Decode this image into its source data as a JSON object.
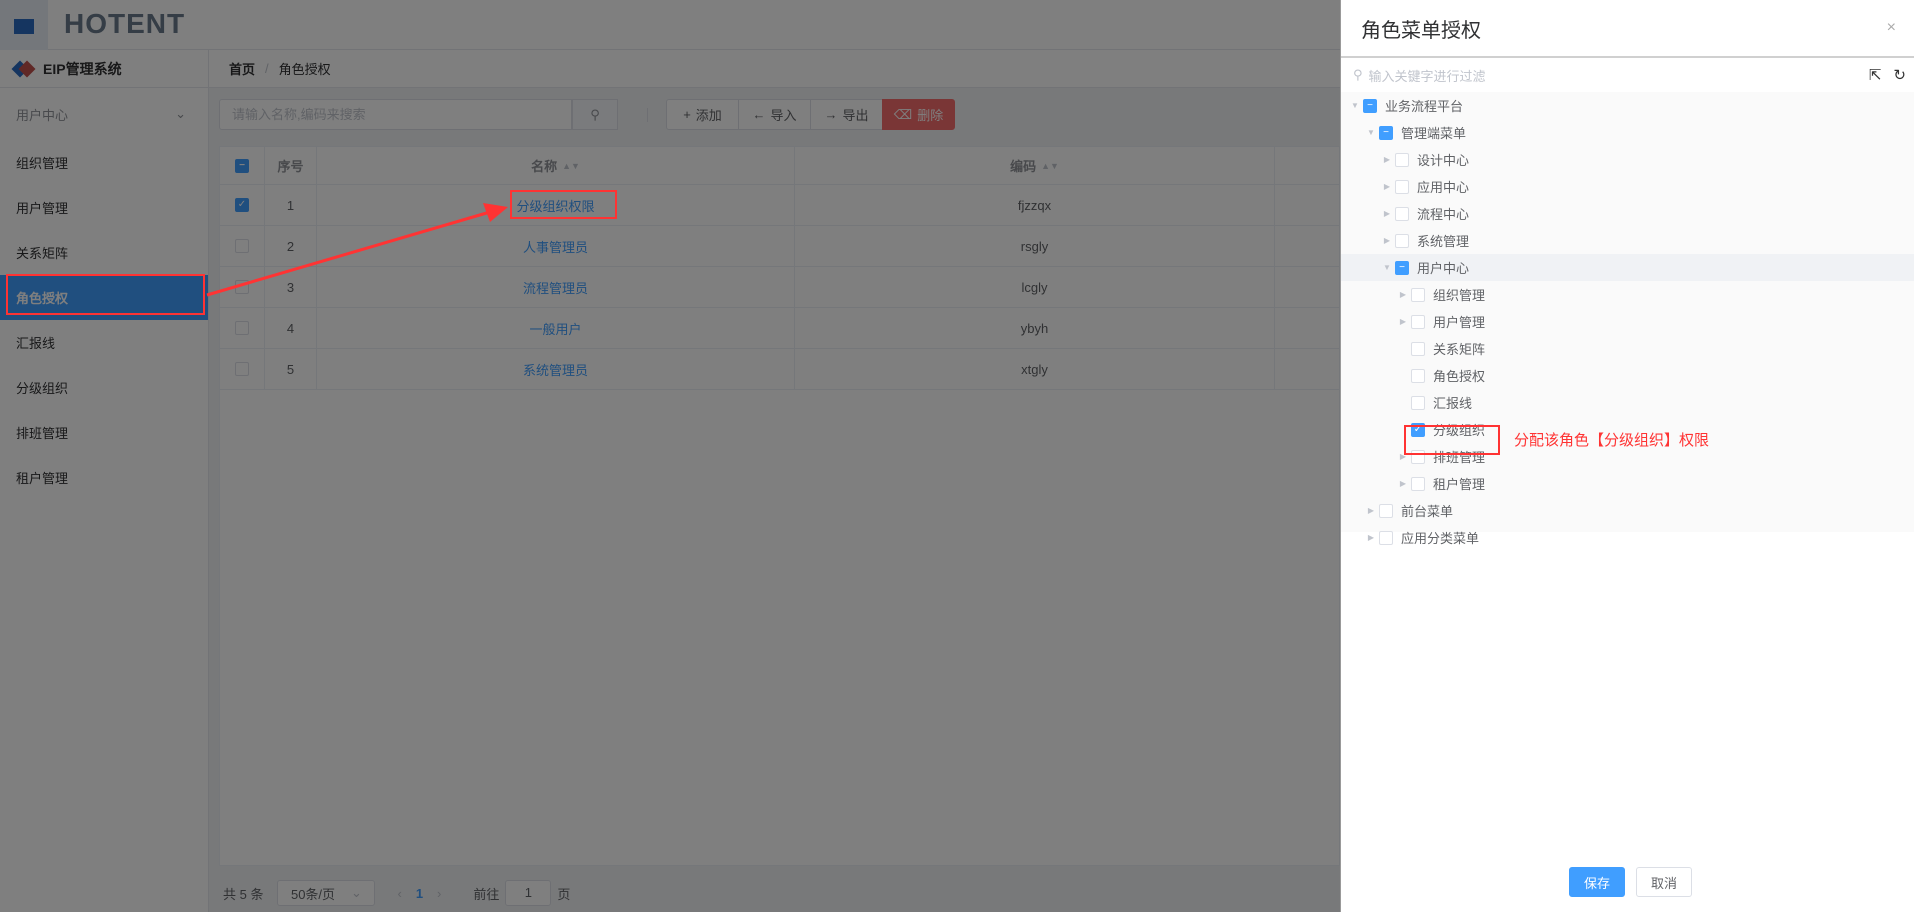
{
  "header": {
    "logo": "HOTENT"
  },
  "sidebar": {
    "system": "EIP管理系统",
    "submenu": "用户中心",
    "items": [
      "组织管理",
      "用户管理",
      "关系矩阵",
      "角色授权",
      "汇报线",
      "分级组织",
      "排班管理",
      "租户管理"
    ],
    "active": "角色授权"
  },
  "breadcrumb": {
    "home": "首页",
    "current": "角色授权"
  },
  "toolbar": {
    "search_placeholder": "请输入名称,编码来搜索",
    "add": "添加",
    "import": "导入",
    "export": "导出",
    "delete": "删除"
  },
  "table": {
    "headers": {
      "index": "序号",
      "name": "名称",
      "code": "编码"
    },
    "rows": [
      {
        "index": "1",
        "name": "分级组织权限",
        "code": "fjzzqx",
        "checked": true
      },
      {
        "index": "2",
        "name": "人事管理员",
        "code": "rsgly"
      },
      {
        "index": "3",
        "name": "流程管理员",
        "code": "lcgly"
      },
      {
        "index": "4",
        "name": "一般用户",
        "code": "ybyh"
      },
      {
        "index": "5",
        "name": "系统管理员",
        "code": "xtgly"
      }
    ]
  },
  "pagination": {
    "total": "共 5 条",
    "page_size": "50条/页",
    "current": "1",
    "goto_label": "前往",
    "goto_value": "1",
    "page_suffix": "页"
  },
  "drawer": {
    "title": "角色菜单授权",
    "filter_placeholder": "输入关键字进行过滤",
    "tree": [
      {
        "label": "业务流程平台",
        "level": 0,
        "state": "partial",
        "arrow": "down"
      },
      {
        "label": "管理端菜单",
        "level": 1,
        "state": "partial",
        "arrow": "down"
      },
      {
        "label": "设计中心",
        "level": 2,
        "state": "off",
        "arrow": "right"
      },
      {
        "label": "应用中心",
        "level": 2,
        "state": "off",
        "arrow": "right"
      },
      {
        "label": "流程中心",
        "level": 2,
        "state": "off",
        "arrow": "right"
      },
      {
        "label": "系统管理",
        "level": 2,
        "state": "off",
        "arrow": "right"
      },
      {
        "label": "用户中心",
        "level": 2,
        "state": "partial",
        "arrow": "down"
      },
      {
        "label": "组织管理",
        "level": 3,
        "state": "off",
        "arrow": "right"
      },
      {
        "label": "用户管理",
        "level": 3,
        "state": "off",
        "arrow": "right"
      },
      {
        "label": "关系矩阵",
        "level": 3,
        "state": "off",
        "arrow": ""
      },
      {
        "label": "角色授权",
        "level": 3,
        "state": "off",
        "arrow": ""
      },
      {
        "label": "汇报线",
        "level": 3,
        "state": "off",
        "arrow": ""
      },
      {
        "label": "分级组织",
        "level": 3,
        "state": "on",
        "arrow": ""
      },
      {
        "label": "排班管理",
        "level": 3,
        "state": "off",
        "arrow": "right"
      },
      {
        "label": "租户管理",
        "level": 3,
        "state": "off",
        "arrow": "right"
      },
      {
        "label": "前台菜单",
        "level": 1,
        "state": "off",
        "arrow": "right"
      },
      {
        "label": "应用分类菜单",
        "level": 1,
        "state": "off",
        "arrow": "right"
      }
    ],
    "annotation": "分配该角色【分级组织】权限",
    "save": "保存",
    "cancel": "取消"
  },
  "colors": {
    "primary": "#409eff",
    "danger": "#f56c6c",
    "annotation": "#ff3333"
  }
}
